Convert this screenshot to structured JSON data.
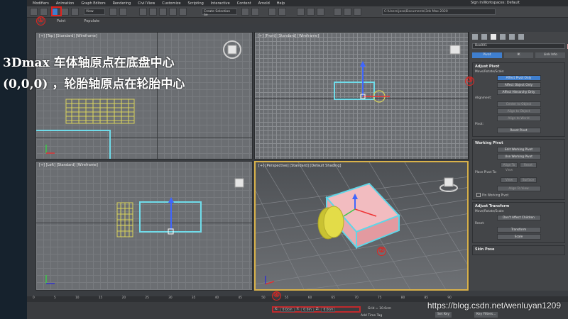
{
  "overlay": {
    "line1": "3Dmax 车体轴原点在底盘中心",
    "line2": "(0,0,0) ，轮胎轴原点在轮胎中心"
  },
  "menubar": {
    "items": [
      "Modifiers",
      "Animation",
      "Graph Editors",
      "Rendering",
      "Civil View",
      "Customize",
      "Scripting",
      "Interactive",
      "Content",
      "Arnold",
      "Help"
    ],
    "signin": "Sign In",
    "workspace": "Workspaces: Default"
  },
  "toolbar": {
    "view_dropdown": "View",
    "selection_set": "Create Selection Se",
    "path": "C:\\Users\\joso\\Documents\\3ds Max 2020"
  },
  "ribbon": {
    "items": [
      "Paint",
      "Populate"
    ]
  },
  "viewports": {
    "top": "[+] [Top] [Standard] [Wireframe]",
    "front": "[+] [Front] [Standard] [Wireframe]",
    "left": "[+] [Left] [Standard] [Wireframe]",
    "perspective": "[+] [Perspective] [Standard] [Default Shading]"
  },
  "command_panel": {
    "object_name": "Box001",
    "tabs": [
      "Pivot",
      "IK",
      "Link Info"
    ],
    "adjust_pivot": {
      "title": "Adjust Pivot",
      "move_label": "Move/Rotate/Scale:",
      "buttons": [
        "Affect Pivot Only",
        "Affect Object Only",
        "Affect Hierarchy Only"
      ],
      "alignment_label": "Alignment:",
      "align_buttons": [
        "Center to Object",
        "Align to Object",
        "Align to World"
      ],
      "pivot_label": "Pivot:",
      "reset_button": "Reset Pivot"
    },
    "working_pivot": {
      "title": "Working Pivot",
      "buttons": [
        "Edit Working Pivot",
        "Use Working Pivot"
      ],
      "row": [
        "Align To View",
        "Reset"
      ],
      "place_label": "Place Pivot To:",
      "place_row": [
        "View",
        "Surface"
      ],
      "align_view": "Align To View",
      "checkbox": "Pin Working Pivot"
    },
    "adjust_transform": {
      "title": "Adjust Transform",
      "move_label": "Move/Rotate/Scale:",
      "button": "Don't Affect Children",
      "reset_label": "Reset:",
      "reset_buttons": [
        "Transform",
        "Scale"
      ]
    },
    "skin_pose": {
      "title": "Skin Pose"
    }
  },
  "timeline": {
    "ticks": [
      "0",
      "5",
      "10",
      "15",
      "20",
      "25",
      "30",
      "35",
      "40",
      "45",
      "50",
      "55",
      "60",
      "65",
      "70",
      "75",
      "80",
      "85",
      "90"
    ]
  },
  "status": {
    "x_label": "X:",
    "x_value": "0.0cm",
    "y_label": "Y:",
    "y_value": "0.0m",
    "z_label": "Z:",
    "z_value": "0.0cm",
    "grid": "Grid = 10.0cm",
    "add_time_tag": "Add Time Tag",
    "set_key": "Set Key",
    "key_filters": "Key Filters..."
  },
  "callouts": [
    "①",
    "②",
    "③",
    "④"
  ],
  "watermark": "https://blog.csdn.net/wenluyan1209",
  "colors": {
    "box_fill": "#e9a9ad",
    "box_outline": "#5fd6e8",
    "wheel": "#d8d23a",
    "wire_yellow": "#d9d35a",
    "selection_cyan": "#6fdcea",
    "callout_red": "#e0241f",
    "active_border": "#d9b24a"
  }
}
